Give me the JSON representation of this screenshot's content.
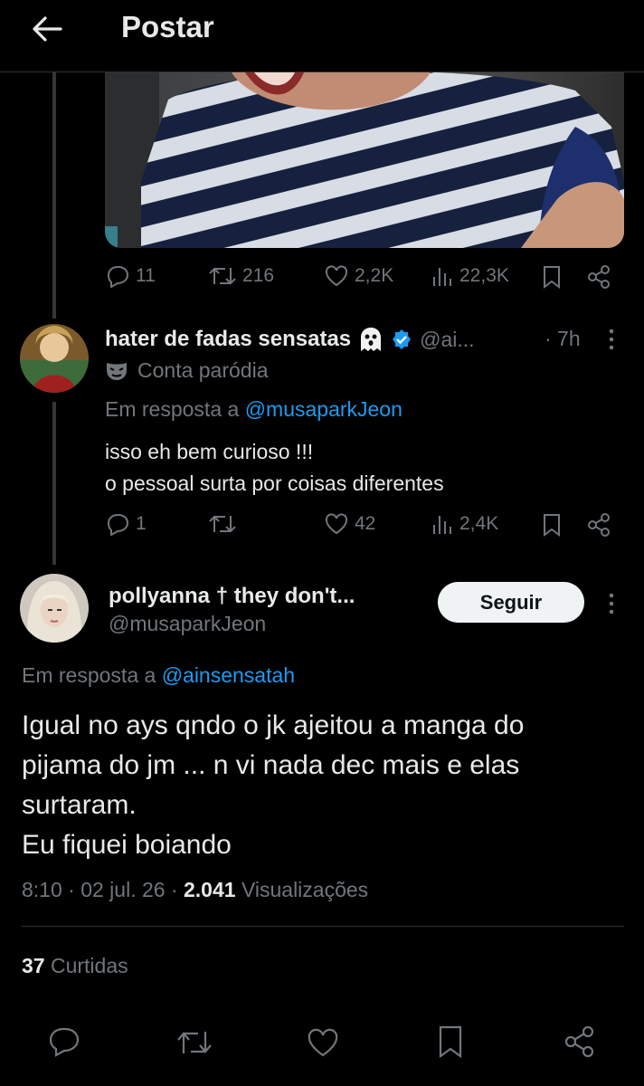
{
  "header": {
    "title": "Postar"
  },
  "previous_tweet_stats": {
    "replies": "11",
    "reposts": "216",
    "likes": "2,2K",
    "views": "22,3K"
  },
  "reply_tweet": {
    "name": "hater de fadas sensatas",
    "handle": "@ai...",
    "time": "· 7h",
    "label": "Conta paródia",
    "reply_prefix": "Em resposta a",
    "reply_to": "@musaparkJeon",
    "text_line1": "isso eh bem curioso !!!",
    "text_line2": "o pessoal surta por coisas diferentes",
    "stats": {
      "replies": "1",
      "likes": "42",
      "views": "2,4K"
    }
  },
  "main_tweet": {
    "name": "pollyanna † they don't...",
    "handle": "@musaparkJeon",
    "follow_label": "Seguir",
    "reply_prefix": "Em resposta a",
    "reply_to": "@ainsensatah",
    "text": "Igual no ays qndo o jk ajeitou a manga do\npijama do jm ... n vi nada dec mais e elas\nsurtaram.\nEu fiquei boiando",
    "time": "8:10 · 02 jul. 26 ·",
    "views_count": "2.041",
    "views_label": "Visualizações",
    "likes_count": "37",
    "likes_label": "Curtidas"
  },
  "colors": {
    "accent": "#1d9bf0",
    "background": "#000000",
    "text": "#e7e9ea",
    "muted": "#71767b"
  }
}
